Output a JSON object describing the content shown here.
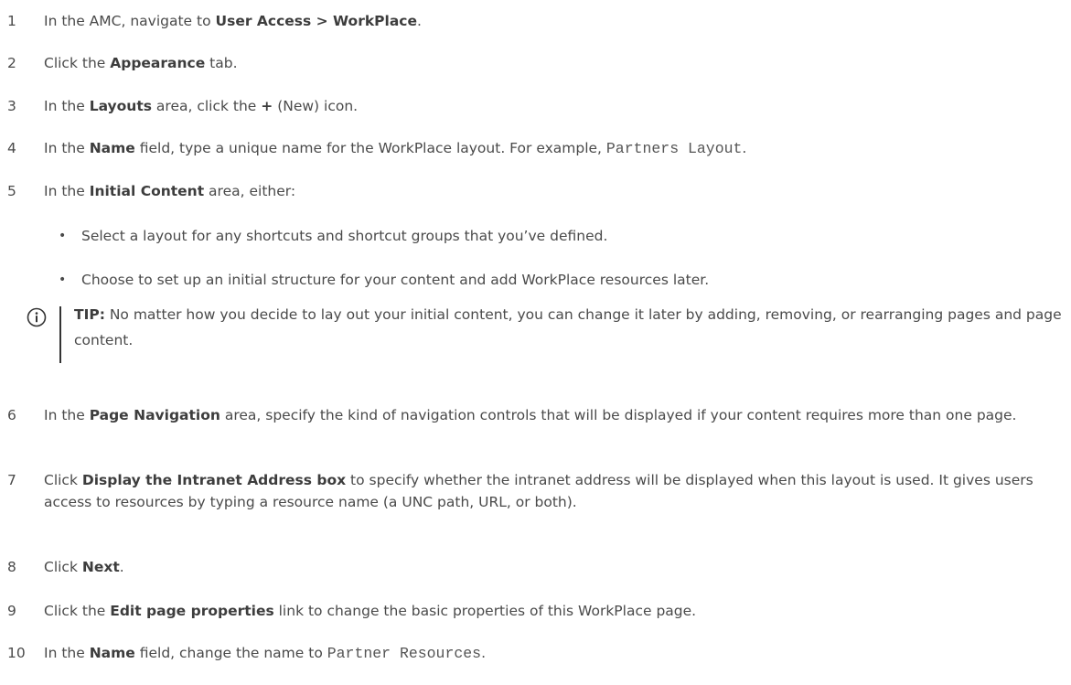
{
  "steps": [
    {
      "num": "1",
      "parts": [
        "In the AMC, navigate to ",
        "User Access > WorkPlace",
        "."
      ]
    },
    {
      "num": "2",
      "parts": [
        "Click the ",
        "Appearance",
        " tab."
      ]
    },
    {
      "num": "3",
      "parts": [
        "In the ",
        "Layouts",
        " area, click the ",
        "+",
        " (New) icon."
      ]
    },
    {
      "num": "4",
      "parts": [
        "In the ",
        "Name",
        " field, type a unique name for the WorkPlace layout. For example, ",
        "Partners Layout",
        "."
      ]
    },
    {
      "num": "5",
      "parts": [
        "In the ",
        "Initial Content",
        " area, either:"
      ]
    },
    {
      "num": "6",
      "parts": [
        "In the ",
        "Page Navigation",
        " area, specify the kind of navigation controls that will be displayed if your content requires more than one page."
      ]
    },
    {
      "num": "7",
      "parts": [
        "Click ",
        "Display the Intranet Address box",
        " to specify whether the intranet address will be displayed when this layout is used. It gives users access to resources by typing a resource name (a UNC path, URL, or both)."
      ]
    },
    {
      "num": "8",
      "parts": [
        "Click ",
        "Next",
        "."
      ]
    },
    {
      "num": "9",
      "parts": [
        "Click the ",
        "Edit page properties",
        " link to change the basic properties of this WorkPlace page."
      ]
    },
    {
      "num": "10",
      "parts": [
        "In the ",
        "Name",
        " field, change the name to ",
        "Partner Resources",
        "."
      ]
    }
  ],
  "bullets": [
    "Select a layout for any shortcuts and shortcut groups that you’ve defined.",
    "Choose to set up an initial structure for your content and add WorkPlace resources later."
  ],
  "bullet_glyph": "•",
  "tip": {
    "label": "TIP:",
    "text": " No matter how you decide to lay out your initial content, you can change it later by adding, removing, or rearranging pages and page content.",
    "icon": "info-icon"
  }
}
